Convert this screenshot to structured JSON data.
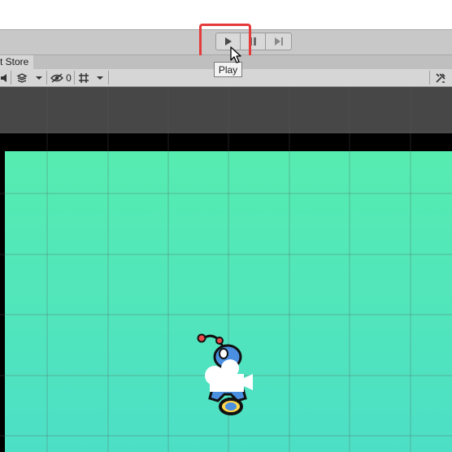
{
  "toolbar": {
    "play_label": "Play",
    "tooltip": "Play"
  },
  "tabs": {
    "store_label": "t Store"
  },
  "scene_toolbar": {
    "hidden_count": "0"
  },
  "colors": {
    "highlight": "#e53a3a",
    "game_top": "#56ecb0",
    "game_bottom": "#4ddfc6",
    "scene_dark": "#474747"
  },
  "icons": [
    "play-icon",
    "pause-icon",
    "step-icon",
    "audio-icon",
    "effects-icon",
    "dropdown-icon",
    "visibility-icon",
    "grid-icon",
    "tools-icon",
    "cursor-icon",
    "camera-icon"
  ]
}
